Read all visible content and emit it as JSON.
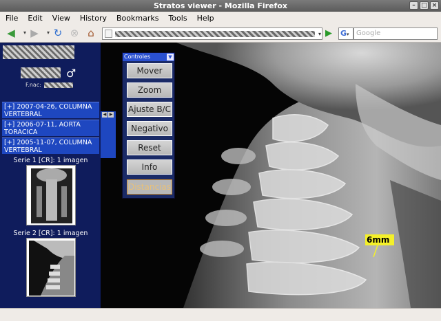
{
  "window": {
    "title": "Stratos viewer - Mozilla Firefox"
  },
  "menu": [
    "File",
    "Edit",
    "View",
    "History",
    "Bookmarks",
    "Tools",
    "Help"
  ],
  "toolbar": {
    "search_placeholder": "Google",
    "search_engine": "G"
  },
  "patient": {
    "gender_symbol": "♂",
    "dob_label": "F.nac:"
  },
  "studies": [
    {
      "label": "[+] 2007-04-26, COLUMNA VERTEBRAL"
    },
    {
      "label": "[+] 2006-07-11, AORTA TORACICA"
    },
    {
      "label": "[+] 2005-11-07, COLUMNA VERTEBRAL"
    }
  ],
  "series": [
    {
      "label": "Serie 1 [CR]: 1 imagen"
    },
    {
      "label": "Serie 2 [CR]: 1 imagen"
    }
  ],
  "controls": {
    "title": "Controles",
    "buttons": [
      "Mover",
      "Zoom",
      "Ajuste B/C",
      "Negativo",
      "Reset",
      "Info",
      "Distancias"
    ]
  },
  "measurement": {
    "label": "6mm"
  },
  "colors": {
    "panel": "#0f1c5c",
    "study_row": "#1e47c0",
    "measure": "#f4f02a"
  },
  "icons": {
    "back": "back-arrow-icon",
    "forward": "forward-arrow-icon",
    "reload": "reload-icon",
    "stop": "stop-icon",
    "home": "home-icon"
  }
}
